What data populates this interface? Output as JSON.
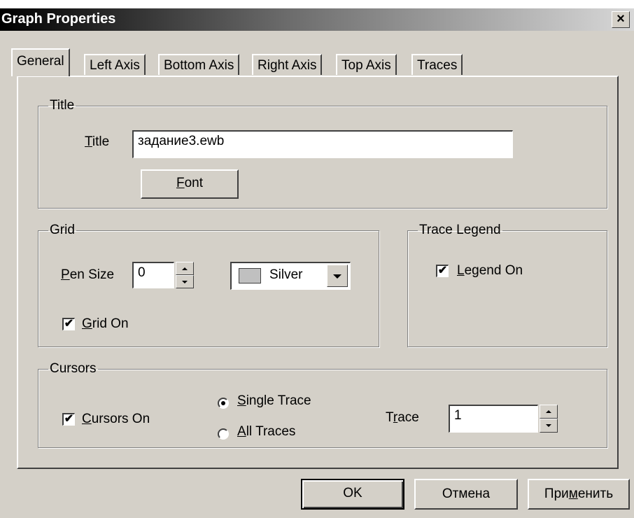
{
  "window": {
    "title": "Graph Properties",
    "close_glyph": "×"
  },
  "tabs": [
    {
      "label": "General",
      "active": true
    },
    {
      "label": "Left Axis",
      "active": false
    },
    {
      "label": "Bottom Axis",
      "active": false
    },
    {
      "label": "Right Axis",
      "active": false
    },
    {
      "label": "Top Axis",
      "active": false
    },
    {
      "label": "Traces",
      "active": false
    }
  ],
  "title_group": {
    "legend": "Title",
    "field_label_mnemonic": "T",
    "field_label_rest": "itle",
    "field_value": "задание3.ewb",
    "font_button_mnemonic": "F",
    "font_button_rest": "ont"
  },
  "grid_group": {
    "legend": "Grid",
    "pen_size_mnemonic": "P",
    "pen_size_rest": "en Size",
    "pen_size_value": "0",
    "color_value": "Silver",
    "color_swatch": "#c0c0c0",
    "grid_on_checked": true,
    "grid_on_mnemonic": "G",
    "grid_on_rest": "rid On",
    "check_glyph": "✔"
  },
  "legend_group": {
    "legend": "Trace Legend",
    "legend_on_checked": true,
    "legend_on_mnemonic": "L",
    "legend_on_rest": "egend On",
    "check_glyph": "✔"
  },
  "cursors_group": {
    "legend": "Cursors",
    "cursors_on_checked": true,
    "cursors_on_mnemonic": "C",
    "cursors_on_rest": "ursors On",
    "single_trace_mnemonic": "S",
    "single_trace_rest": "ingle Trace",
    "single_trace_selected": true,
    "all_traces_mnemonic": "A",
    "all_traces_rest": "ll Traces",
    "trace_label_pre": "T",
    "trace_label_mnemonic": "r",
    "trace_label_post": "ace",
    "trace_value": "1",
    "check_glyph": "✔"
  },
  "buttons": {
    "ok": "OK",
    "cancel": "Отмена",
    "apply_pre": "При",
    "apply_mnemonic": "м",
    "apply_post": "енить"
  }
}
